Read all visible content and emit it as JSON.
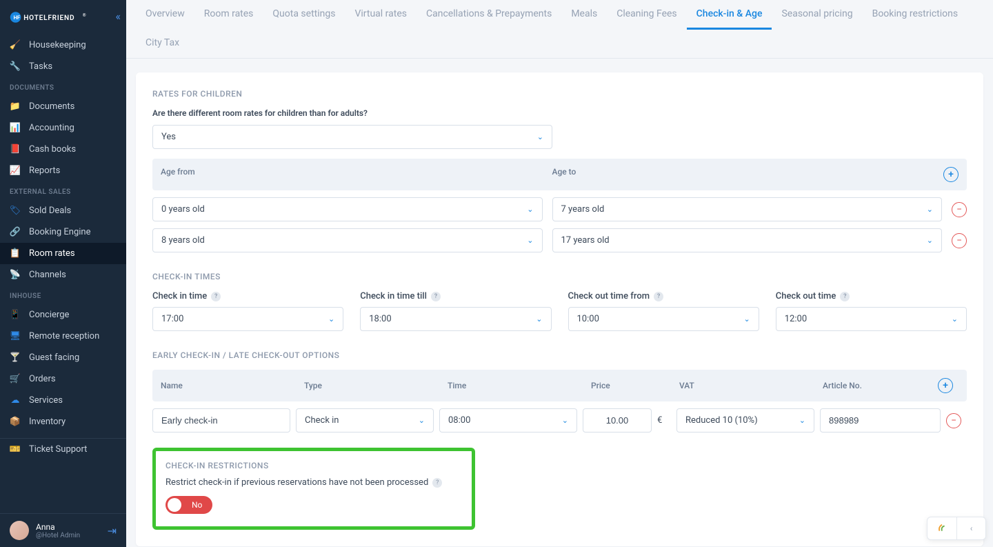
{
  "brand": "HOTELFRIEND",
  "sidebar": {
    "items": [
      {
        "label": "Housekeeping",
        "icon": "🧹"
      },
      {
        "label": "Tasks",
        "icon": "🔧"
      }
    ],
    "section_documents": "DOCUMENTS",
    "docs": [
      {
        "label": "Documents",
        "icon": "📁"
      },
      {
        "label": "Accounting",
        "icon": "📊"
      },
      {
        "label": "Cash books",
        "icon": "📕"
      },
      {
        "label": "Reports",
        "icon": "📈"
      }
    ],
    "section_external": "EXTERNAL SALES",
    "external": [
      {
        "label": "Sold Deals",
        "icon": "🏷"
      },
      {
        "label": "Booking Engine",
        "icon": "🔗"
      },
      {
        "label": "Room rates",
        "icon": "📋",
        "active": true
      },
      {
        "label": "Channels",
        "icon": "📡"
      }
    ],
    "section_inhouse": "INHOUSE",
    "inhouse": [
      {
        "label": "Concierge",
        "icon": "📱"
      },
      {
        "label": "Remote reception",
        "icon": "🖥"
      },
      {
        "label": "Guest facing",
        "icon": "🍸"
      },
      {
        "label": "Orders",
        "icon": "🛒"
      },
      {
        "label": "Services",
        "icon": "☁"
      },
      {
        "label": "Inventory",
        "icon": "📦"
      }
    ],
    "support": {
      "label": "Ticket Support",
      "icon": "🎫"
    }
  },
  "user": {
    "name": "Anna",
    "role": "@Hotel Admin"
  },
  "tabs": [
    "Overview",
    "Room rates",
    "Quota settings",
    "Virtual rates",
    "Cancellations & Prepayments",
    "Meals",
    "Cleaning Fees",
    "Check-in & Age",
    "Seasonal pricing",
    "Booking restrictions",
    "City Tax"
  ],
  "active_tab": "Check-in & Age",
  "rates_children": {
    "title": "RATES FOR CHILDREN",
    "question": "Are there different room rates for children than for adults?",
    "answer": "Yes",
    "col_from": "Age from",
    "col_to": "Age to",
    "rows": [
      {
        "from": "0 years old",
        "to": "7 years old"
      },
      {
        "from": "8 years old",
        "to": "17 years old"
      }
    ]
  },
  "checkin_times": {
    "title": "CHECK-IN TIMES",
    "fields": [
      {
        "label": "Check in time",
        "value": "17:00"
      },
      {
        "label": "Check in time till",
        "value": "18:00"
      },
      {
        "label": "Check out time from",
        "value": "10:00"
      },
      {
        "label": "Check out time",
        "value": "12:00"
      }
    ]
  },
  "early_late": {
    "title": "EARLY CHECK-IN / LATE CHECK-OUT OPTIONS",
    "headers": [
      "Name",
      "Type",
      "Time",
      "Price",
      "VAT",
      "Article No."
    ],
    "row": {
      "name": "Early check-in",
      "type": "Check in",
      "time": "08:00",
      "price": "10.00",
      "currency": "€",
      "vat": "Reduced 10 (10%)",
      "article": "898989"
    }
  },
  "restrictions": {
    "title": "CHECK-IN RESTRICTIONS",
    "label": "Restrict check-in if previous reservations have not been processed",
    "value": "No"
  }
}
